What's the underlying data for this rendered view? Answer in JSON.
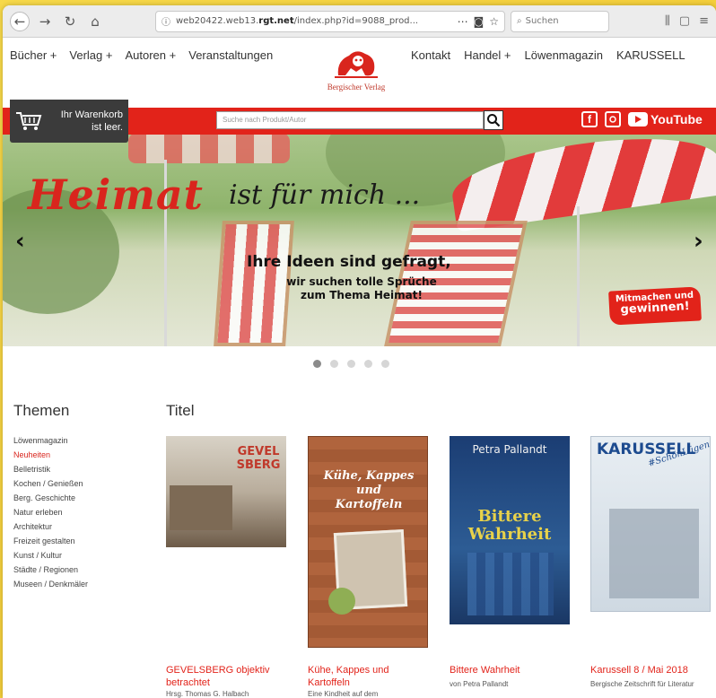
{
  "browser": {
    "url_prefix": "web20422.web13.",
    "url_domain": "rgt.net",
    "url_suffix": "/index.php?id=9088_prod...",
    "search_placeholder": "Suchen",
    "more_icon": "⋯"
  },
  "nav": {
    "left": [
      "Bücher +",
      "Verlag +",
      "Autoren +",
      "Veranstaltungen"
    ],
    "right": [
      "Kontakt",
      "Handel +",
      "Löwenmagazin",
      "KARUSSELL"
    ],
    "logo_text": "Bergischer Verlag"
  },
  "cart": {
    "line1": "Ihr Warenkorb",
    "line2": "ist leer."
  },
  "product_search": {
    "placeholder": "Suche nach Produkt/Autor"
  },
  "social": {
    "facebook": "f",
    "youtube": "YouTube"
  },
  "hero": {
    "title_red": "Heimat",
    "title_rest": "ist für mich ...",
    "line1": "Ihre Ideen sind gefragt,",
    "line2": "wir suchen tolle Sprüche",
    "line3": "zum Thema Heimat!",
    "badge_line1": "Mitmachen und",
    "badge_line2": "gewinnen!",
    "prev": "‹",
    "next": "›",
    "slides": 5,
    "active_slide": 1
  },
  "themen": {
    "heading": "Themen",
    "items": [
      {
        "label": "Löwenmagazin",
        "active": false
      },
      {
        "label": "Neuheiten",
        "active": true
      },
      {
        "label": "Belletristik",
        "active": false
      },
      {
        "label": "Kochen / Genießen",
        "active": false
      },
      {
        "label": "Berg. Geschichte",
        "active": false
      },
      {
        "label": "Natur erleben",
        "active": false
      },
      {
        "label": "Architektur",
        "active": false
      },
      {
        "label": "Freizeit gestalten",
        "active": false
      },
      {
        "label": "Kunst / Kultur",
        "active": false
      },
      {
        "label": "Städte / Regionen",
        "active": false
      },
      {
        "label": "Museen / Denkmäler",
        "active": false
      }
    ]
  },
  "titel": {
    "heading": "Titel",
    "books": [
      {
        "title": "GEVELSBERG objektiv betrachtet",
        "sub": "Hrsg. Thomas G. Halbach",
        "cover_text": "GEVELSBERG"
      },
      {
        "title": "Kühe, Kappes und Kartoffeln",
        "sub": "Eine Kindheit auf dem",
        "cover_text": "Kühe, Kappes und Kartoffeln"
      },
      {
        "title": "Bittere Wahrheit",
        "sub": "von Petra Pallandt",
        "cover_author": "Petra Pallandt",
        "cover_text": "Bittere Wahrheit"
      },
      {
        "title": "Karussell 8 / Mai 2018",
        "sub": "Bergische Zeitschrift für Literatur",
        "cover_text": "KARUSSELL",
        "cover_tag": "#SchönLügen"
      }
    ]
  },
  "colors": {
    "brand_red": "#e2231a",
    "nav_text": "#333333"
  }
}
